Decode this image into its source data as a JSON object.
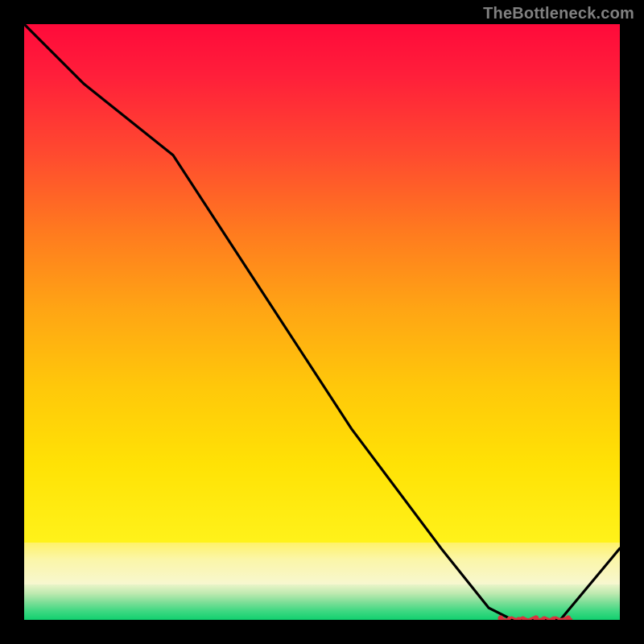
{
  "attribution": "TheBottleneck.com",
  "chart_data": {
    "type": "line",
    "title": "",
    "xlabel": "",
    "ylabel": "",
    "xlim": [
      0,
      100
    ],
    "ylim": [
      0,
      100
    ],
    "grid": false,
    "legend": false,
    "series": [
      {
        "name": "curve",
        "x": [
          0,
          10,
          25,
          40,
          55,
          70,
          78,
          82,
          86,
          90,
          100
        ],
        "y": [
          100,
          90,
          78,
          55,
          32,
          12,
          2,
          0,
          0,
          0,
          12
        ]
      }
    ],
    "flat_region": {
      "x_start": 80,
      "x_end": 92,
      "y": 0
    },
    "gradient_stops_main": [
      {
        "pos": 0.0,
        "color": "#ff0a3a"
      },
      {
        "pos": 0.25,
        "color": "#ff4a2f"
      },
      {
        "pos": 0.55,
        "color": "#ffa514"
      },
      {
        "pos": 0.85,
        "color": "#ffe205"
      },
      {
        "pos": 1.0,
        "color": "#fff21a"
      }
    ],
    "gradient_stops_green": [
      {
        "pos": 0.0,
        "color": "#e9f4c8"
      },
      {
        "pos": 0.5,
        "color": "#7fdf98"
      },
      {
        "pos": 1.0,
        "color": "#11d06f"
      }
    ]
  }
}
